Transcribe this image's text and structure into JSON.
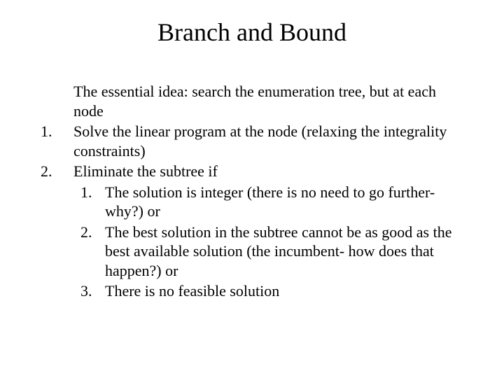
{
  "title": "Branch and Bound",
  "intro": "The essential idea:  search the enumeration tree, but at each node",
  "items": [
    {
      "marker": "1.",
      "text": "Solve the linear program at the node (relaxing the integrality constraints)"
    },
    {
      "marker": "2.",
      "text": "Eliminate the subtree if"
    }
  ],
  "subitems": [
    {
      "marker": "1.",
      "text": "The solution is integer (there is no need to go further- why?) or"
    },
    {
      "marker": "2.",
      "text": "The best solution in the subtree cannot be as good as the best available solution (the incumbent- how does that happen?) or"
    },
    {
      "marker": "3.",
      "text": "There is no feasible solution"
    }
  ]
}
